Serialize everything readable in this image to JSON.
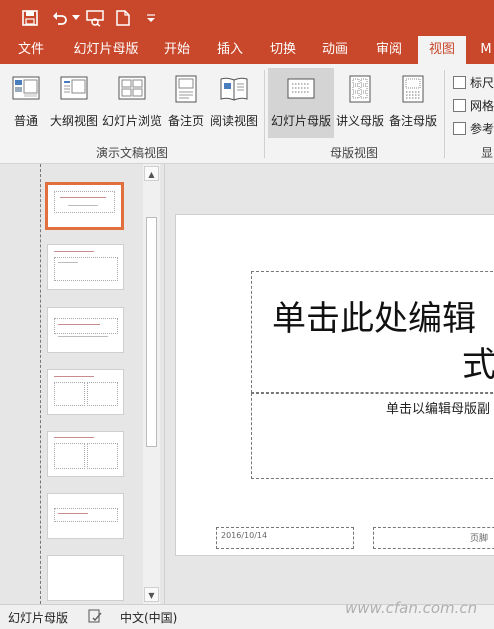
{
  "quick_access": {
    "icons": [
      "save-icon",
      "undo-icon",
      "undo-dropdown-icon",
      "presentation-icon",
      "new-file-icon",
      "customize-icon"
    ]
  },
  "tabs": [
    {
      "label": "文件"
    },
    {
      "label": "幻灯片母版"
    },
    {
      "label": "开始"
    },
    {
      "label": "插入"
    },
    {
      "label": "切换"
    },
    {
      "label": "动画"
    },
    {
      "label": "审阅"
    },
    {
      "label": "视图",
      "active": true
    },
    {
      "label": "M"
    }
  ],
  "ribbon": {
    "groups": [
      {
        "label": "演示文稿视图"
      },
      {
        "label": "母版视图"
      },
      {
        "label": "显"
      }
    ],
    "buttons": [
      {
        "label": "普通",
        "icon": "normal-view-icon"
      },
      {
        "label": "大纲视图",
        "icon": "outline-view-icon"
      },
      {
        "label": "幻灯片浏览",
        "icon": "slide-sorter-icon"
      },
      {
        "label": "备注页",
        "icon": "notes-page-icon"
      },
      {
        "label": "阅读视图",
        "icon": "reading-view-icon"
      },
      {
        "label": "幻灯片母版",
        "icon": "slide-master-icon",
        "selected": true
      },
      {
        "label": "讲义母版",
        "icon": "handout-master-icon"
      },
      {
        "label": "备注母版",
        "icon": "notes-master-icon"
      }
    ],
    "checkboxes": [
      {
        "label": "标尺",
        "checked": false
      },
      {
        "label": "网格",
        "checked": false
      },
      {
        "label": "参考",
        "checked": false
      }
    ]
  },
  "slide": {
    "title_line1": "单击此处编辑",
    "title_line2": "式",
    "subtitle": "单击以编辑母版副",
    "date": "2016/10/14",
    "footer": "页脚"
  },
  "status": {
    "mode": "幻灯片母版",
    "language": "中文(中国)"
  },
  "watermark": "www.cfan.com.cn",
  "colors": {
    "accent": "#c9472a",
    "selection": "#e2703f"
  }
}
